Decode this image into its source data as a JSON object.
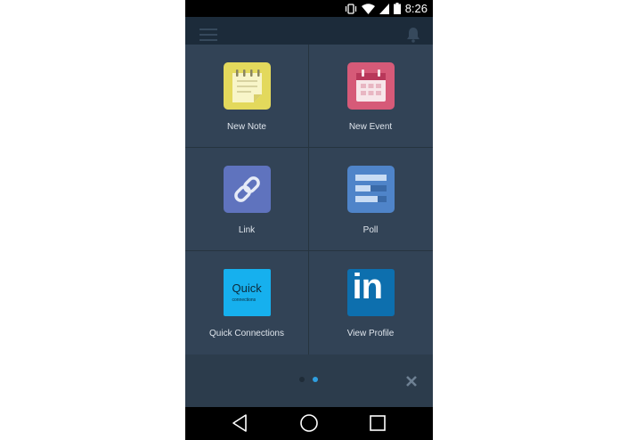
{
  "status_bar": {
    "time": "8:26",
    "icons": [
      "vibrate-icon",
      "wifi-icon",
      "signal-icon",
      "battery-icon"
    ]
  },
  "app_bar": {
    "icons": [
      "menu-icon",
      "bell-icon"
    ]
  },
  "tiles": [
    {
      "label": "New Note",
      "icon": "note-icon",
      "color": "#e3d95c"
    },
    {
      "label": "New Event",
      "icon": "calendar-icon",
      "color": "#d65a78"
    },
    {
      "label": "Link",
      "icon": "link-icon",
      "color": "#5f73be"
    },
    {
      "label": "Poll",
      "icon": "poll-icon",
      "color": "#4f84c9"
    },
    {
      "label": "Quick Connections",
      "icon": "quick-connections-icon",
      "color": "#16b0ee",
      "icon_text": "Quick",
      "icon_subtext": "connections"
    },
    {
      "label": "View Profile",
      "icon": "linkedin-icon",
      "color": "#0d6fae",
      "icon_text": "in"
    }
  ],
  "pager": {
    "page_count": 2,
    "active_page": 2,
    "inactive_color": "#1f2c38",
    "active_color": "#2f9fe0"
  },
  "colors": {
    "background": "#324356",
    "app_bar": "#1c2b3a",
    "bottom_area": "#2c3c4c",
    "label_text": "#dfe5ec"
  },
  "nav_bar": {
    "icons": [
      "back-icon",
      "home-icon",
      "recents-icon"
    ]
  }
}
